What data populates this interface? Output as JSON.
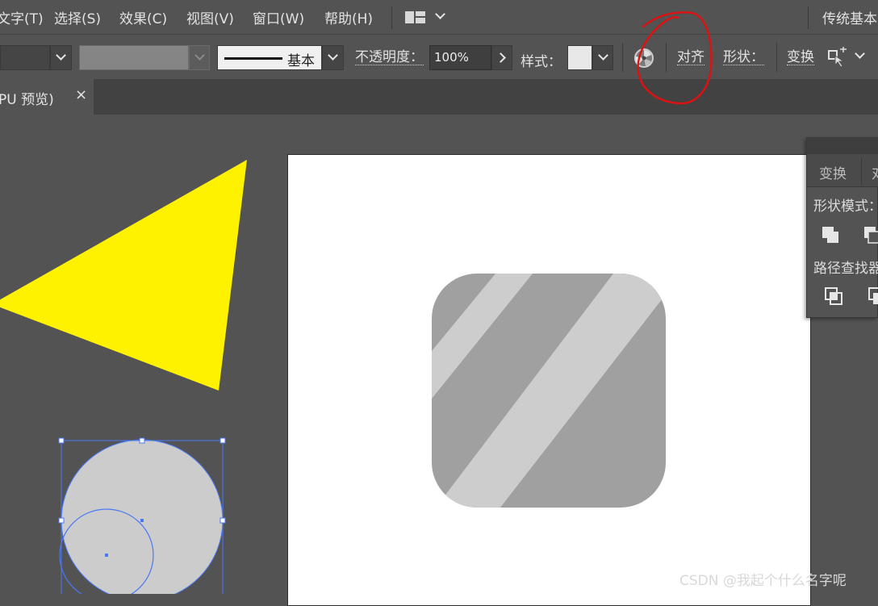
{
  "menubar": {
    "items": [
      "文字(T)",
      "选择(S)",
      "效果(C)",
      "视图(V)",
      "窗口(W)",
      "帮助(H)"
    ],
    "workspace": "传统基本"
  },
  "control_bar": {
    "stroke_style": "基本",
    "opacity_label": "不透明度：",
    "opacity_value": "100%",
    "style_label": "样式：",
    "align_label": "对齐",
    "shape_label": "形状：",
    "transform_label": "变换"
  },
  "tab": {
    "title": "PU 预览)",
    "close": "×"
  },
  "panel": {
    "tabs": [
      "变换",
      "对"
    ],
    "shape_modes_label": "形状模式：",
    "pathfinder_label": "路径查找器"
  },
  "artwork": {
    "triangle_color": "#FFF200",
    "rounded_square_color": "#A0A0A0",
    "stripe_color": "#CDCDCD",
    "circle_color": "#CCCCCC",
    "selection_color": "#4A78F5"
  },
  "annotation": {
    "color": "#E01010"
  },
  "watermark": "CSDN @我起个什么名字呢"
}
